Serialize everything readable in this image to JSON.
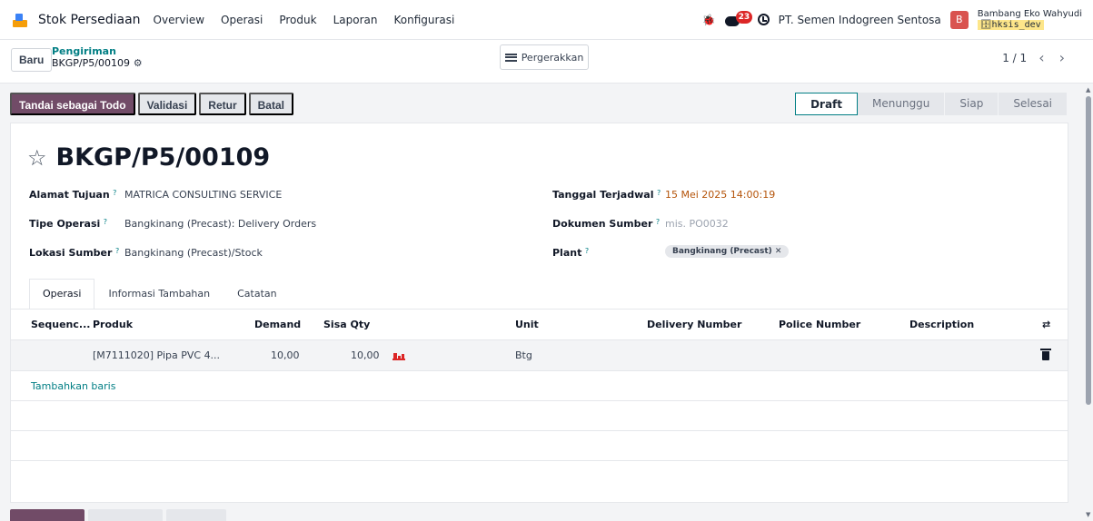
{
  "navbar": {
    "app_title": "Stok Persediaan",
    "menu": [
      "Overview",
      "Operasi",
      "Produk",
      "Laporan",
      "Konfigurasi"
    ],
    "message_count": "23",
    "company": "PT. Semen Indogreen Sentosa",
    "user_initial": "B",
    "user_name": "Bambang Eko Wahyudi",
    "database": "hksis_dev"
  },
  "control": {
    "new_label": "Baru",
    "breadcrumb_parent": "Pengiriman",
    "breadcrumb_current": "BKGP/P5/00109",
    "moves_label": "Pergerakkan",
    "pager": "1 / 1"
  },
  "actions": {
    "todo": "Tandai sebagai Todo",
    "validate": "Validasi",
    "return": "Retur",
    "cancel": "Batal"
  },
  "stages": [
    "Draft",
    "Menunggu",
    "Siap",
    "Selesai"
  ],
  "record": {
    "name": "BKGP/P5/00109",
    "left_fields": [
      {
        "label": "Alamat Tujuan",
        "value": "MATRICA CONSULTING SERVICE"
      },
      {
        "label": "Tipe Operasi",
        "value": "Bangkinang (Precast): Delivery Orders"
      },
      {
        "label": "Lokasi Sumber",
        "value": "Bangkinang (Precast)/Stock"
      }
    ],
    "right_fields": [
      {
        "label": "Tanggal Terjadwal",
        "value": "15 Mei 2025 14:00:19"
      },
      {
        "label": "Dokumen Sumber",
        "value": "mis. PO0032"
      },
      {
        "label": "Plant",
        "value": "Bangkinang (Precast) ✕"
      }
    ]
  },
  "tabs": [
    "Operasi",
    "Informasi Tambahan",
    "Catatan"
  ],
  "table": {
    "headers": [
      "Sequenc...",
      "Produk",
      "Demand",
      "Sisa Qty",
      "Unit",
      "Delivery Number",
      "Police Number",
      "Description"
    ],
    "rows": [
      {
        "product": "[M7111020] Pipa PVC 4...",
        "demand": "10,00",
        "remaining": "10,00",
        "unit": "Btg"
      }
    ],
    "add_line": "Tambahkan baris"
  },
  "colors": {
    "primary": "#714b67",
    "accent": "#017e84",
    "warning": "#b45309",
    "danger": "#dc2626"
  }
}
